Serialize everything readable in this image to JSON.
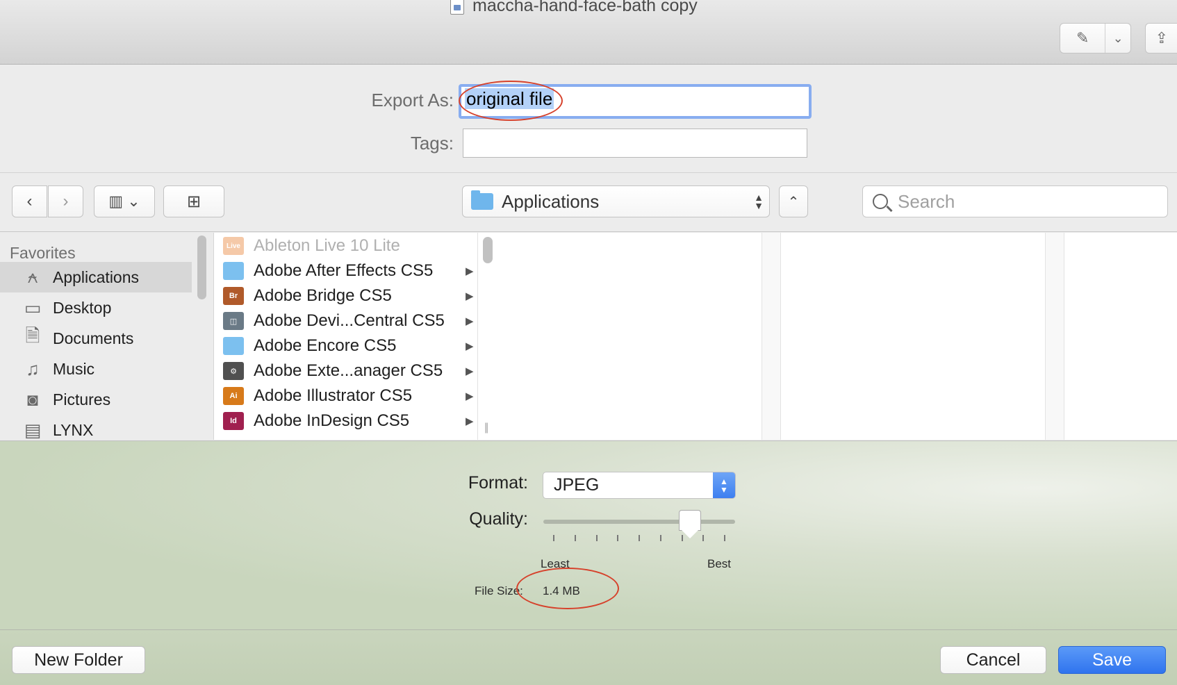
{
  "window": {
    "title": "maccha-hand-face-bath copy",
    "toolbar_icons": [
      "pencil-icon",
      "chevron-down-icon",
      "share-icon"
    ]
  },
  "export": {
    "export_as_label": "Export As:",
    "export_as_value": "original file",
    "tags_label": "Tags:",
    "tags_value": ""
  },
  "nav": {
    "location": "Applications",
    "search_placeholder": "Search"
  },
  "sidebar": {
    "heading": "Favorites",
    "items": [
      {
        "label": "Applications",
        "icon": "applications-icon",
        "selected": true
      },
      {
        "label": "Desktop",
        "icon": "desktop-icon",
        "selected": false
      },
      {
        "label": "Documents",
        "icon": "documents-icon",
        "selected": false
      },
      {
        "label": "Music",
        "icon": "music-icon",
        "selected": false
      },
      {
        "label": "Pictures",
        "icon": "camera-icon",
        "selected": false
      },
      {
        "label": "LYNX",
        "icon": "drive-icon",
        "selected": false
      }
    ]
  },
  "files": [
    {
      "name": "Ableton Live 10 Lite",
      "icon_text": "Live",
      "color": "#f5c9a8",
      "dim": true,
      "arrow": false
    },
    {
      "name": "Adobe After Effects CS5",
      "icon_text": "",
      "color": "#7cc0ef",
      "dim": false,
      "arrow": true
    },
    {
      "name": "Adobe Bridge CS5",
      "icon_text": "Br",
      "color": "#b05a2a",
      "dim": false,
      "arrow": true
    },
    {
      "name": "Adobe Devi...Central CS5",
      "icon_text": "◫",
      "color": "#6a7a86",
      "dim": false,
      "arrow": true
    },
    {
      "name": "Adobe Encore CS5",
      "icon_text": "",
      "color": "#7cc0ef",
      "dim": false,
      "arrow": true
    },
    {
      "name": "Adobe Exte...anager CS5",
      "icon_text": "⚙",
      "color": "#505050",
      "dim": false,
      "arrow": true
    },
    {
      "name": "Adobe Illustrator CS5",
      "icon_text": "Ai",
      "color": "#d77a1a",
      "dim": false,
      "arrow": true
    },
    {
      "name": "Adobe InDesign CS5",
      "icon_text": "Id",
      "color": "#a0204f",
      "dim": false,
      "arrow": true
    }
  ],
  "options": {
    "format_label": "Format:",
    "format_value": "JPEG",
    "quality_label": "Quality:",
    "quality_level": 0.8,
    "least_label": "Least",
    "best_label": "Best",
    "file_size_label": "File Size:",
    "file_size_value": "1.4 MB"
  },
  "buttons": {
    "new_folder": "New Folder",
    "cancel": "Cancel",
    "save": "Save"
  },
  "colors": {
    "accent": "#3478f6",
    "annotation": "#d6412b"
  }
}
